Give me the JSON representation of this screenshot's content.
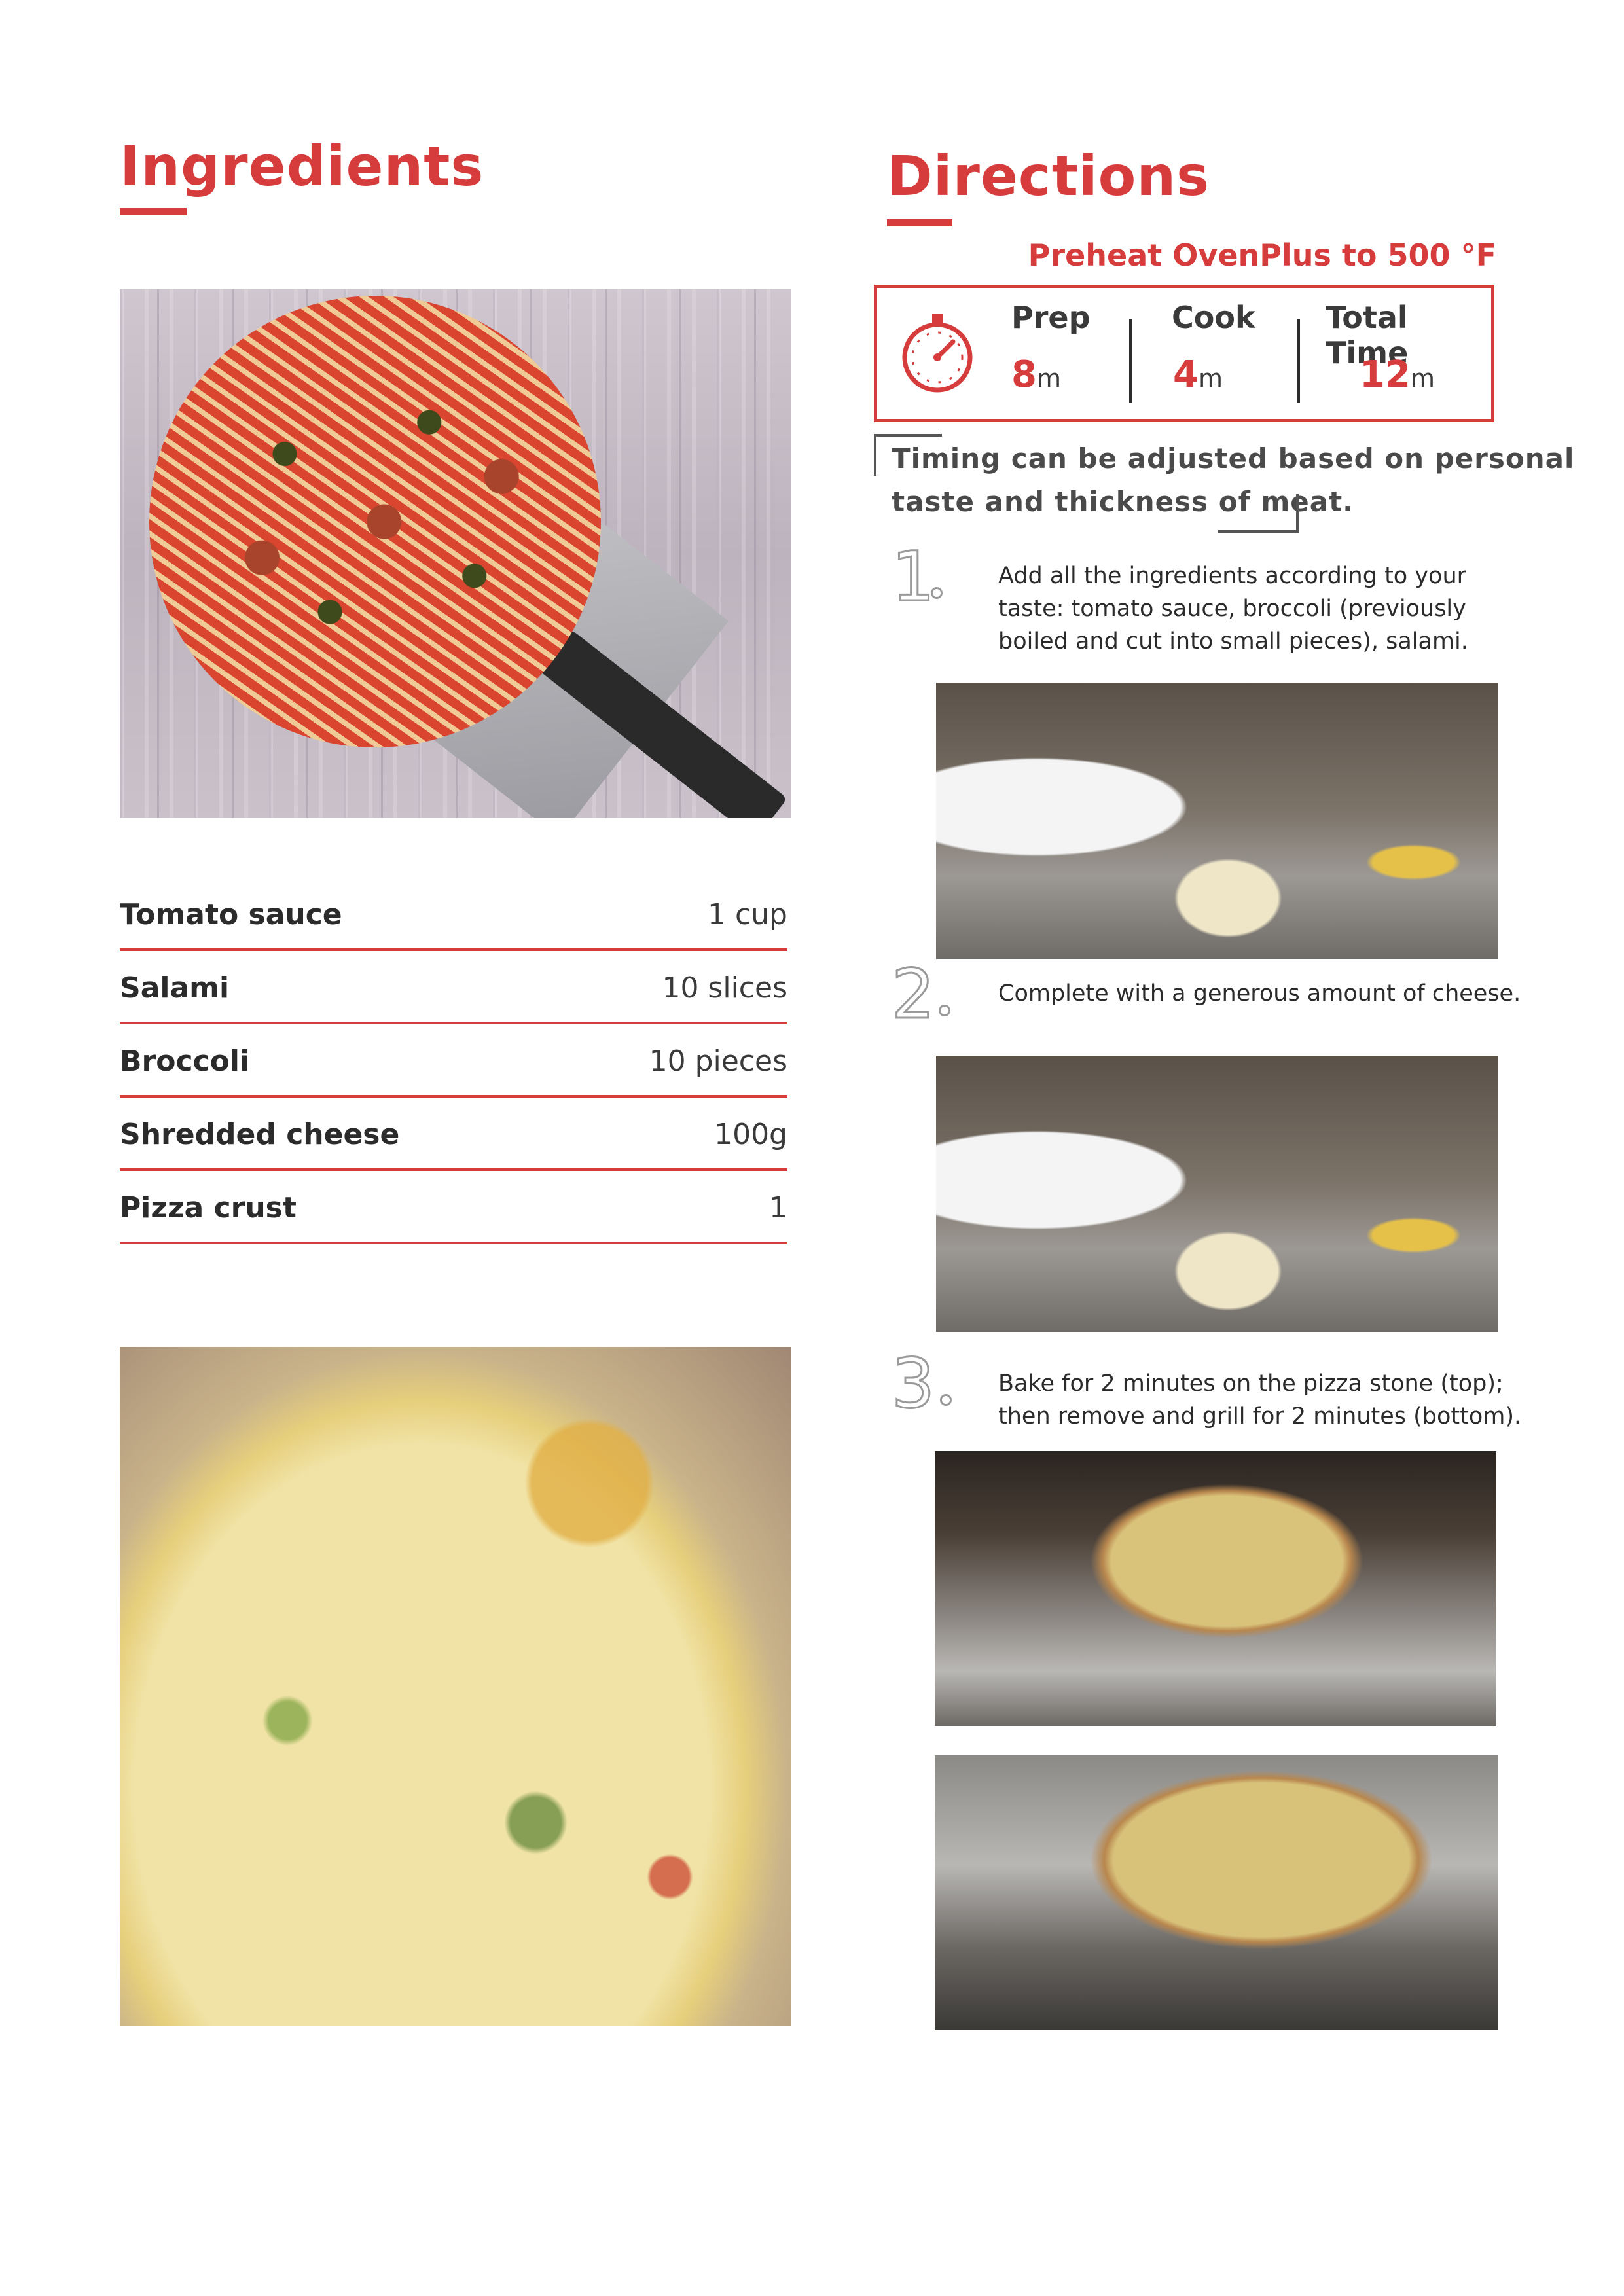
{
  "ingredients": {
    "title": "Ingredients",
    "items": [
      {
        "name": "Tomato sauce",
        "qty": "1 cup"
      },
      {
        "name": "Salami",
        "qty": "10 slices"
      },
      {
        "name": "Broccoli",
        "qty": "10 pieces"
      },
      {
        "name": "Shredded cheese",
        "qty": "100g"
      },
      {
        "name": "Pizza crust",
        "qty": "1"
      }
    ]
  },
  "directions": {
    "title": "Directions",
    "preheat": "Preheat OvenPlus to 500 °F",
    "times": {
      "prep_label": "Prep",
      "prep_value": "8",
      "prep_unit": "m",
      "cook_label": "Cook",
      "cook_value": "4",
      "cook_unit": "m",
      "total_label": "Total Time",
      "total_value": "12",
      "total_unit": "m"
    },
    "note_line1": "Timing can be adjusted based on personal",
    "note_line2": "taste and thickness of meat.",
    "steps": [
      {
        "num": "1",
        "line1": "Add all the ingredients according to your",
        "line2": "taste: tomato sauce, broccoli (previously",
        "line3": "boiled and cut into small pieces), salami."
      },
      {
        "num": "2",
        "line1": "Complete with a generous amount of cheese."
      },
      {
        "num": "3",
        "line1": "Bake for 2 minutes on the pizza stone (top);",
        "line2": "then remove and grill for 2 minutes (bottom)."
      }
    ]
  },
  "icons": {
    "timer": "stopwatch-icon"
  },
  "colors": {
    "accent": "#d63c3c",
    "text": "#2b2b2b"
  }
}
